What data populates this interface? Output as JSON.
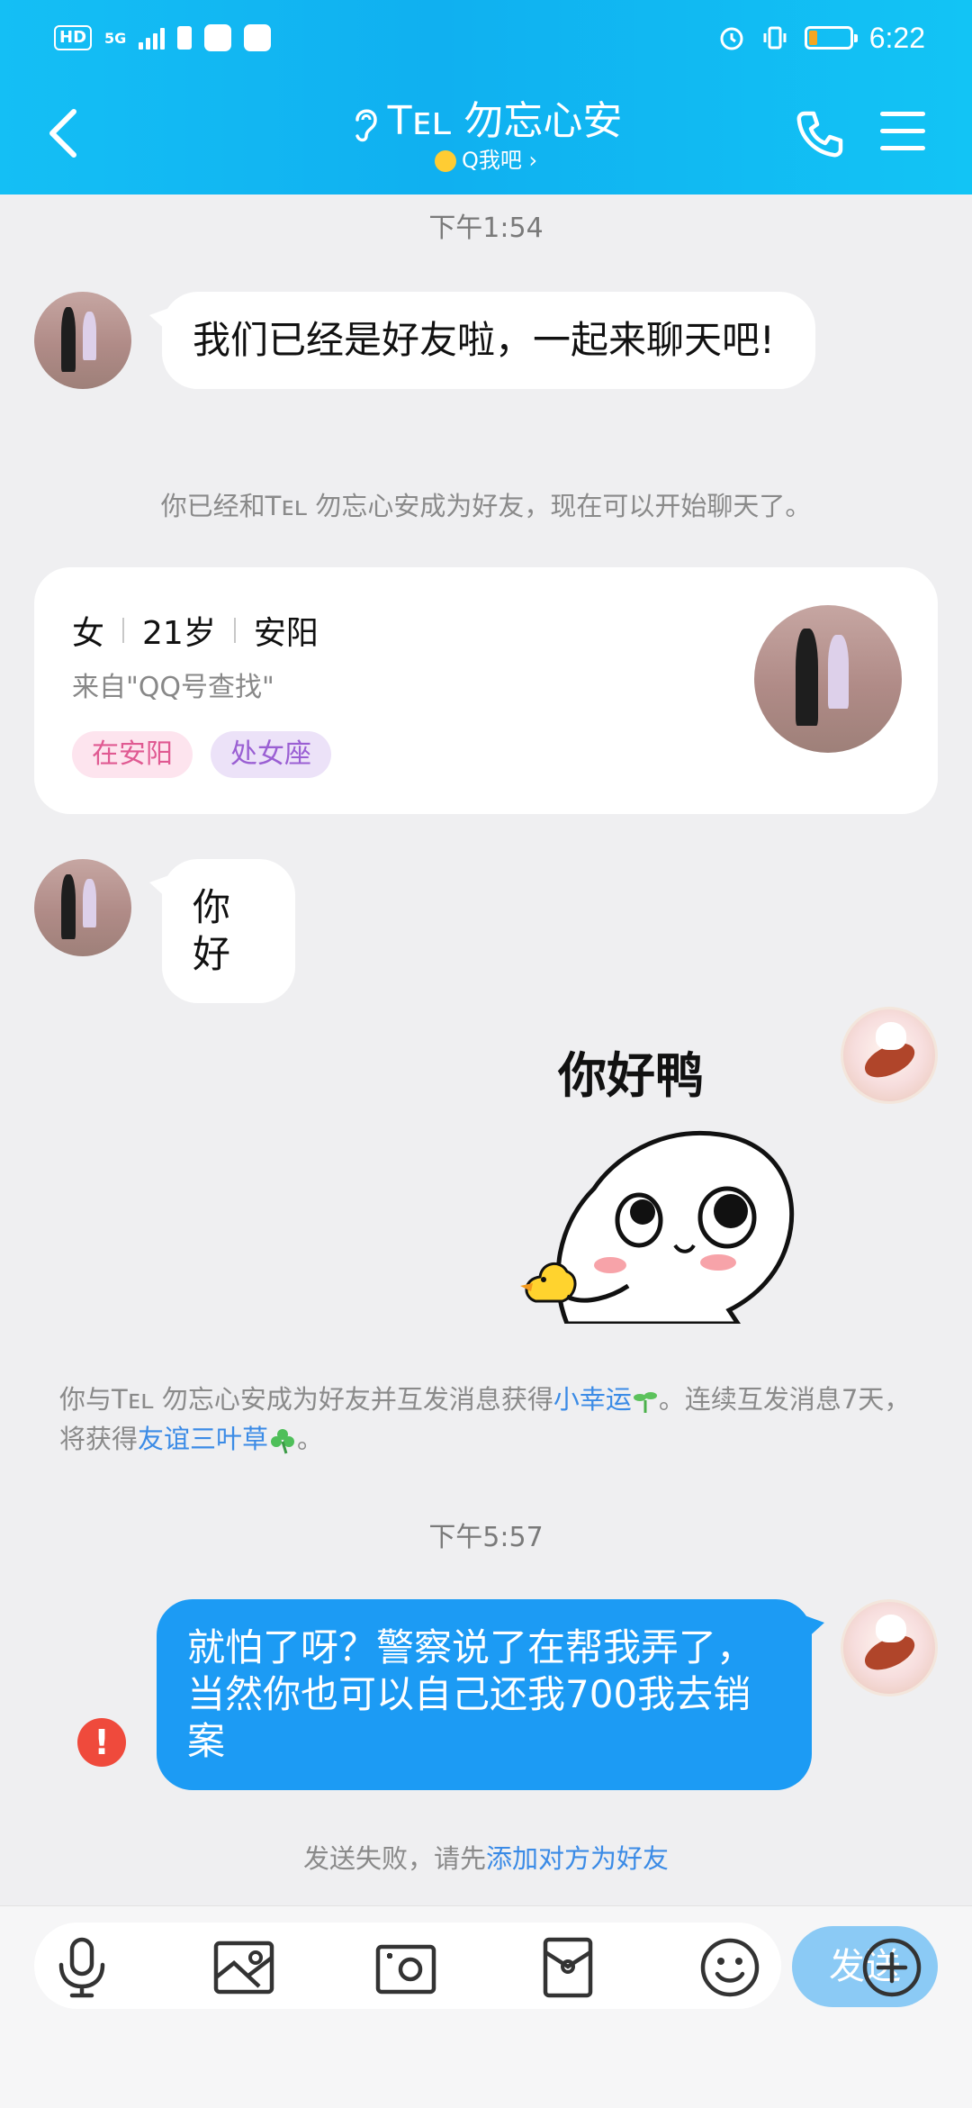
{
  "status_bar": {
    "hd": "HD",
    "network": "5G",
    "time": "6:22",
    "battery_level": 0.2,
    "battery_color": "#f5a623"
  },
  "header": {
    "title": "Tᴇʟ 勿忘心安",
    "subtitle": "Q我吧 ›",
    "gradient_color": "#14bff5"
  },
  "chat": {
    "time_1": "下午1:54",
    "message_1": "我们已经是好友啦，一起来聊天吧!",
    "friend_notice": "你已经和Tᴇʟ 勿忘心安成为好友，现在可以开始聊天了。",
    "profile_card": {
      "gender": "女",
      "age": "21岁",
      "city": "安阳",
      "source": "来自\"QQ号查找\"",
      "tags": [
        "在安阳",
        "处女座"
      ]
    },
    "message_2": "你好",
    "sticker": {
      "caption": "你好鸭",
      "icon": "smiley-duck-sticker"
    },
    "luck_notice": {
      "prefix": "你与Tᴇʟ 勿忘心安成为好友并互发消息获得",
      "link_1": "小幸运",
      "middle": "。连续互发消息7天，将获得",
      "link_2": "友谊三叶草",
      "suffix": "。"
    },
    "time_2": "下午5:57",
    "sent_message": "就怕了呀？警察说了在帮我弄了，当然你也可以自己还我700我去销案",
    "send_failed": {
      "prefix": "发送失败，请先",
      "link": "添加对方为好友"
    },
    "accent_color": "#1c9bf4",
    "link_color": "#3b8be6",
    "error_color": "#ef4a3c"
  },
  "input_bar": {
    "placeholder": "",
    "send_label": "发送",
    "tools": [
      "microphone-icon",
      "image-icon",
      "camera-icon",
      "red-packet-icon",
      "emoji-icon",
      "plus-icon"
    ]
  }
}
